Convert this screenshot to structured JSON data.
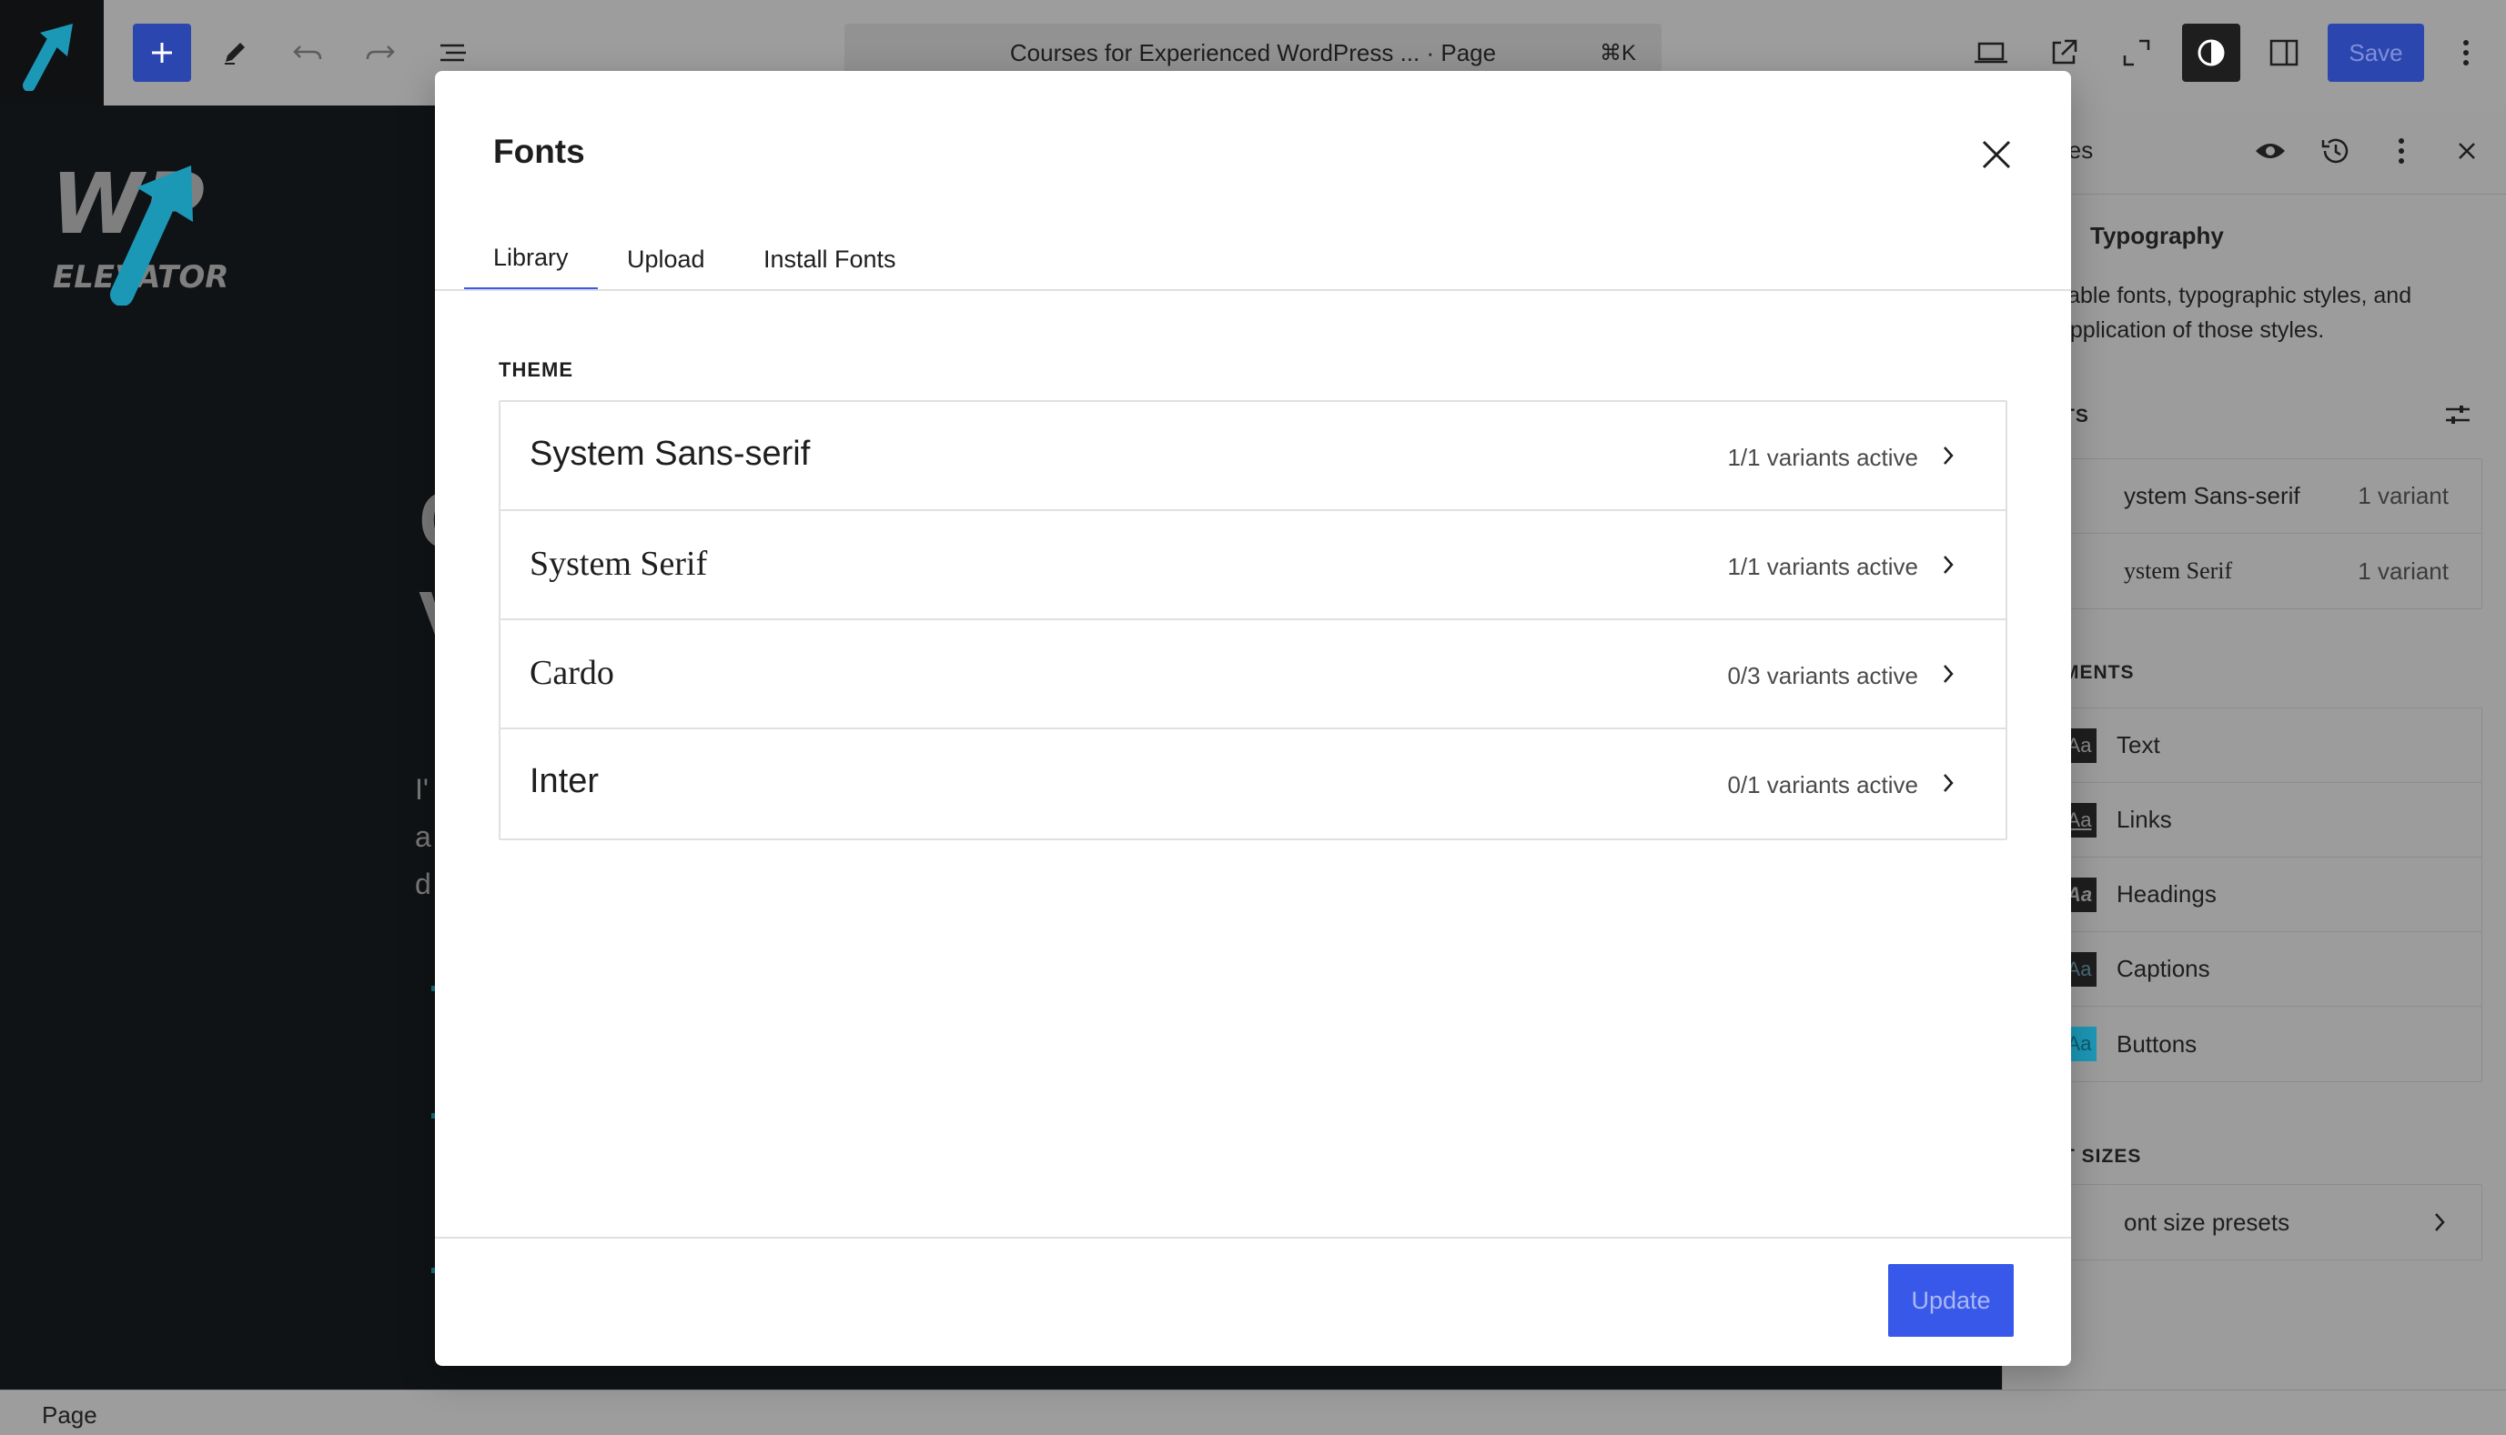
{
  "toolbar": {
    "document_title": "Courses for Experienced WordPress ... · Page",
    "shortcut": "⌘K",
    "save_label": "Save"
  },
  "canvas": {
    "logo_text": [
      "WP",
      "ELEVATOR"
    ],
    "heading_fragments": [
      "C",
      "V"
    ],
    "text_fragments": [
      "I'",
      "a",
      "d"
    ]
  },
  "sidebar": {
    "header_title": "les",
    "back_title": "Typography",
    "description": "ilable fonts, typographic styles, and\n application of those styles.",
    "fonts_section": "TS",
    "fonts": [
      {
        "name": "ystem Sans-serif",
        "variants": "1 variant"
      },
      {
        "name": "ystem Serif",
        "variants": "1 variant"
      }
    ],
    "elements_section": "MENTS",
    "elements": [
      {
        "swatch": "Aa",
        "label": "Text"
      },
      {
        "swatch": "Aa",
        "label": "Links"
      },
      {
        "swatch": "Aa",
        "label": "Headings"
      },
      {
        "swatch": "Aa",
        "label": "Captions"
      },
      {
        "swatch": "Aa",
        "label": "Buttons"
      }
    ],
    "sizes_section": "T SIZES",
    "sizes_row": "ont size presets"
  },
  "modal": {
    "title": "Fonts",
    "tabs": [
      "Library",
      "Upload",
      "Install Fonts"
    ],
    "active_tab": "Library",
    "section_label": "THEME",
    "fonts": [
      {
        "name": "System Sans-serif",
        "variants": "1/1 variants active"
      },
      {
        "name": "System Serif",
        "variants": "1/1 variants active"
      },
      {
        "name": "Cardo",
        "variants": "0/3 variants active"
      },
      {
        "name": "Inter",
        "variants": "0/1 variants active"
      }
    ],
    "update_label": "Update"
  },
  "statusbar": {
    "label": "Page"
  },
  "colors": {
    "accent": "#3858e9",
    "editor_bg": "#101315",
    "logo_blue": "#1c98b7",
    "overlay_gray": "#9c9c9c"
  },
  "icons": [
    "site-logo-arrow",
    "plus-icon",
    "pencil-icon",
    "undo-icon",
    "redo-icon",
    "list-view-icon",
    "desktop-icon",
    "external-link-icon",
    "fullscreen-icon",
    "contrast-icon",
    "sidebar-icon",
    "more-vertical-icon",
    "eye-icon",
    "history-icon",
    "close-icon",
    "sliders-icon",
    "chevron-right-icon"
  ]
}
